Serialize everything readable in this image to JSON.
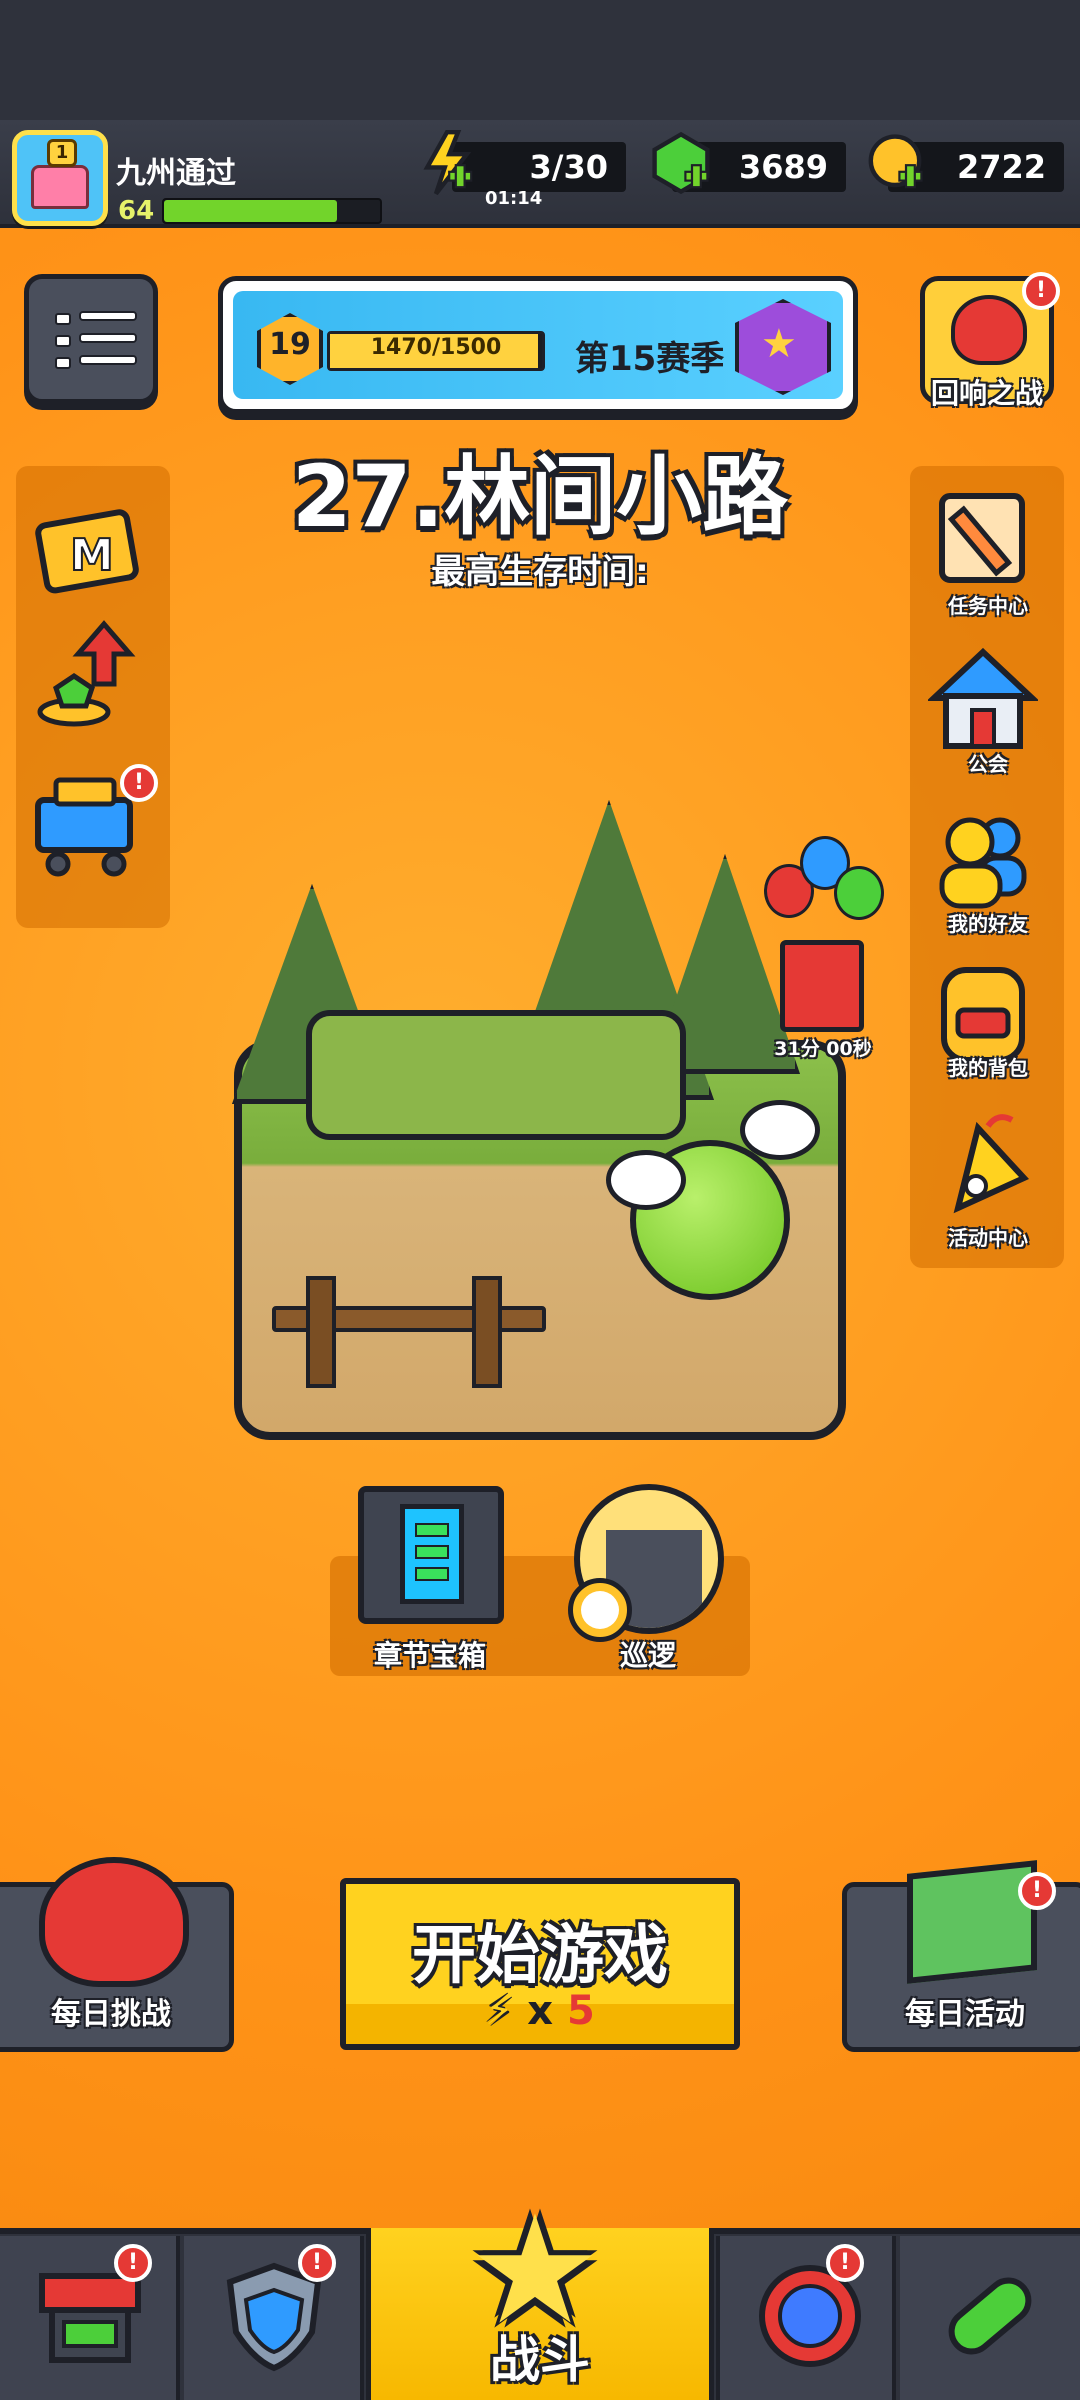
{
  "player": {
    "name": "九州通过",
    "level": "64",
    "avatar_badge": "1",
    "xp_progress": 0.8
  },
  "resources": {
    "energy": {
      "value": "3/30",
      "timer": "01:14",
      "icon": "lightning-icon"
    },
    "gems": {
      "value": "3689",
      "icon": "green-gem-icon"
    },
    "coins": {
      "value": "2722",
      "icon": "gold-coin-icon"
    }
  },
  "season": {
    "level": "19",
    "progress_text": "1470/1500",
    "progress": 0.98,
    "label": "第15赛季"
  },
  "echo_battle": {
    "label": "回响之战",
    "badge": "!"
  },
  "stage": {
    "title": "27.林间小路",
    "survive_label": "最高生存时间:"
  },
  "left_menu": [
    {
      "icon": "m-card-icon"
    },
    {
      "icon": "upgrade-gems-icon"
    },
    {
      "icon": "shop-cart-icon",
      "badge": "!"
    }
  ],
  "right_menu": [
    {
      "label": "任务中心",
      "icon": "quest-scroll-icon"
    },
    {
      "label": "公会",
      "icon": "guild-house-icon"
    },
    {
      "label": "我的好友",
      "icon": "friends-icon"
    },
    {
      "label": "我的背包",
      "icon": "backpack-icon"
    },
    {
      "label": "活动中心",
      "icon": "event-party-icon"
    }
  ],
  "gift": {
    "timer": "31分 00秒"
  },
  "rewards": {
    "chest_label": "章节宝箱",
    "patrol_label": "巡逻"
  },
  "actions": {
    "daily_challenge": "每日挑战",
    "start_game": "开始游戏",
    "start_cost_x": "x",
    "start_cost": "5",
    "daily_event": "每日活动",
    "badge": "!"
  },
  "bottom_nav": {
    "active_label": "战斗",
    "badge": "!"
  },
  "colors": {
    "background": "#ff9a1a",
    "dark": "#1e2028",
    "accent_yellow": "#ffd21f",
    "xp_green": "#72d42b",
    "badge_red": "#e53935"
  }
}
